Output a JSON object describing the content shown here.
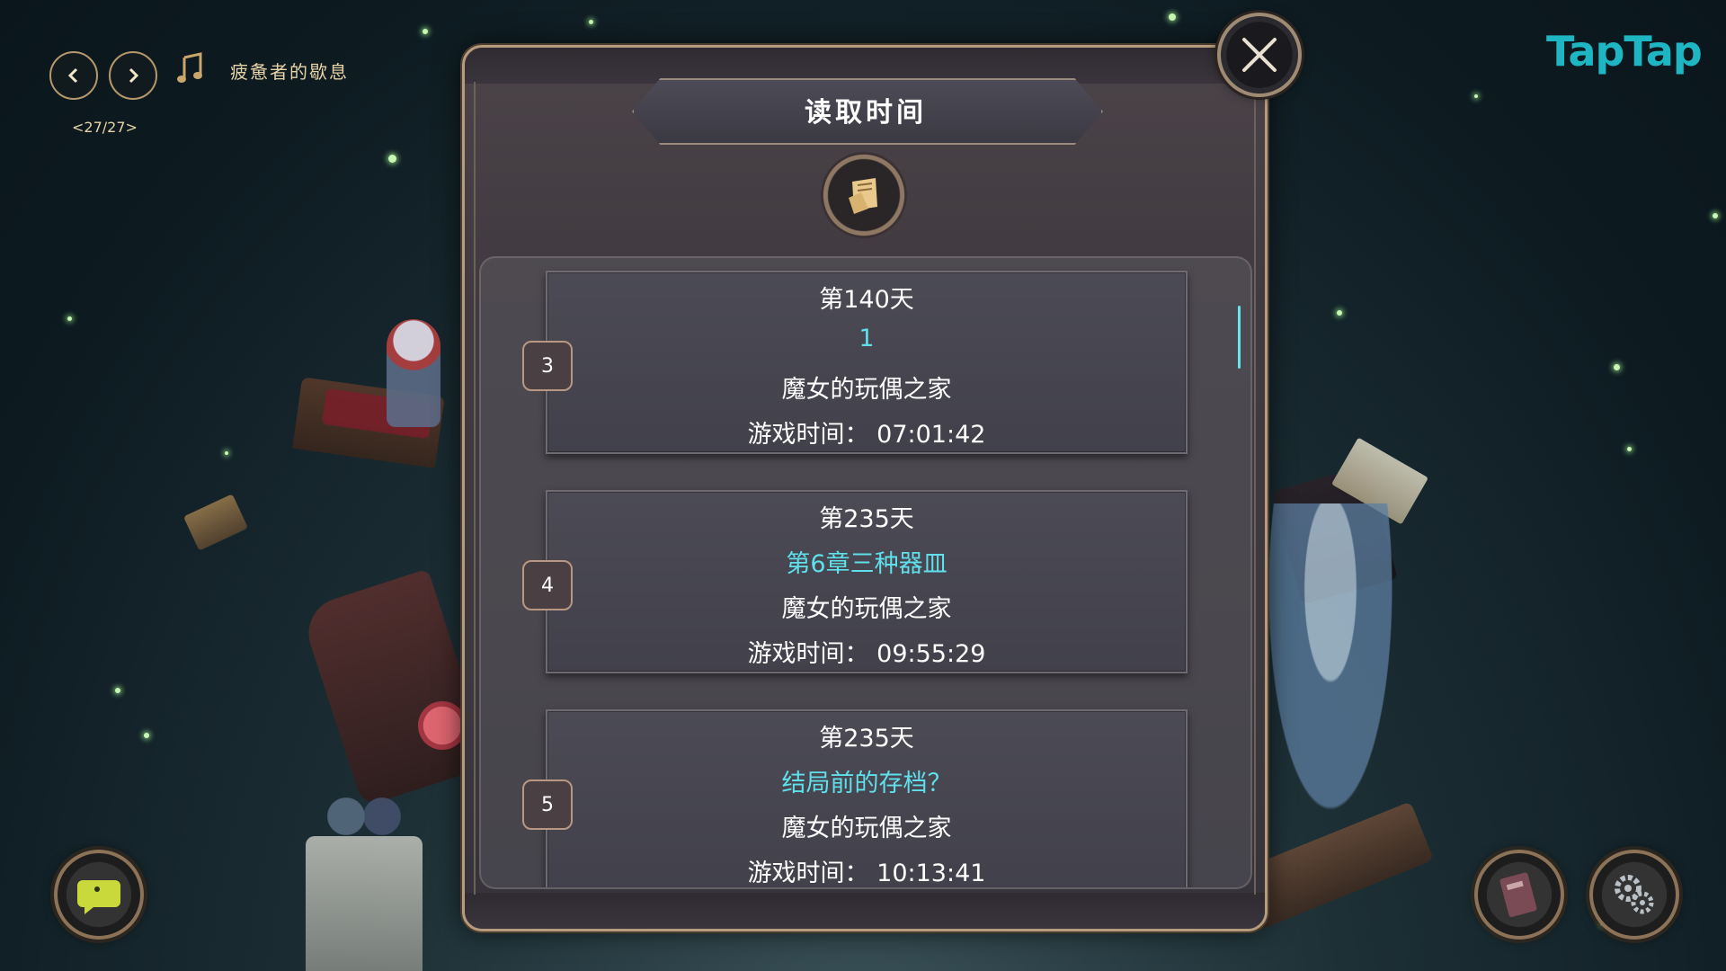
{
  "music": {
    "prev_label": "‹",
    "next_label": "›",
    "track_title": "疲惫者的歇息",
    "track_counter": "<27/27>"
  },
  "logo": {
    "text": "TapTap"
  },
  "dialog": {
    "title": "读取时间",
    "saves": [
      {
        "slot": "3",
        "day": "第140天",
        "name": "1",
        "location": "魔女的玩偶之家",
        "playtime_label": "游戏时间：",
        "playtime": "07:01:42"
      },
      {
        "slot": "4",
        "day": "第235天",
        "name": "第6章三种器皿",
        "location": "魔女的玩偶之家",
        "playtime_label": "游戏时间：",
        "playtime": "09:55:29"
      },
      {
        "slot": "5",
        "day": "第235天",
        "name": "结局前的存档？",
        "location": "魔女的玩偶之家",
        "playtime_label": "游戏时间：",
        "playtime": "10:13:41"
      }
    ]
  },
  "icons": {
    "close": "close-icon",
    "music": "music-note-icon",
    "emblem": "scroll-icon",
    "chat": "chat-icon",
    "journal": "journal-icon",
    "settings": "gear-icon"
  },
  "colors": {
    "accent": "#5fe0ea",
    "gold": "#b69c7c",
    "logo": "#1fb6c4"
  }
}
